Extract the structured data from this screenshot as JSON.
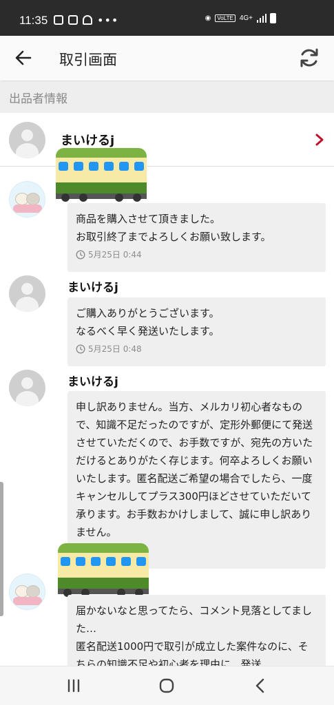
{
  "status_bar": {
    "time": "11:35",
    "network": "4G+",
    "volte": "VoLTE"
  },
  "app_bar": {
    "title": "取引画面"
  },
  "seller_section": {
    "heading": "出品者情報",
    "seller_name": "まいけるj"
  },
  "messages": [
    {
      "from": "buyer",
      "text": "商品を購入させて頂きました。\nお取引終了までよろしくお願い致します。",
      "time": "5月25日 0:44"
    },
    {
      "from": "seller",
      "sender": "まいけるj",
      "text": "ご購入ありがとうございます。\nなるべく早く発送いたします。",
      "time": "5月25日 0:48"
    },
    {
      "from": "seller",
      "sender": "まいけるj",
      "text": "申し訳ありません。当方、メルカリ初心者なもので、知識不足だったのですが、定形外郵便にて発送させていただくので、お手数ですが、宛先の方いただけるとありがたく存じます。何卒よろしくお願いいたします。匿名配送ご希望の場合でしたら、一度キャンセルしてプラス300円ほどさせていただいて承ります。お手数おかけしまして、誠に申し訳ありません。"
    },
    {
      "from": "buyer",
      "text": "届かないなと思ってたら、コメント見落としてました…\n匿名配送1000円で取引が成立した案件なのに、そちらの知識不足や初心者を理由に、発送"
    }
  ],
  "icons": [
    "back-arrow-icon",
    "refresh-icon",
    "chevron-right-icon",
    "clock-icon",
    "train-icon"
  ],
  "colors": {
    "accent_red": "#c0112b",
    "bubble_bg": "#efefef",
    "section_bg": "#eeeeee"
  }
}
